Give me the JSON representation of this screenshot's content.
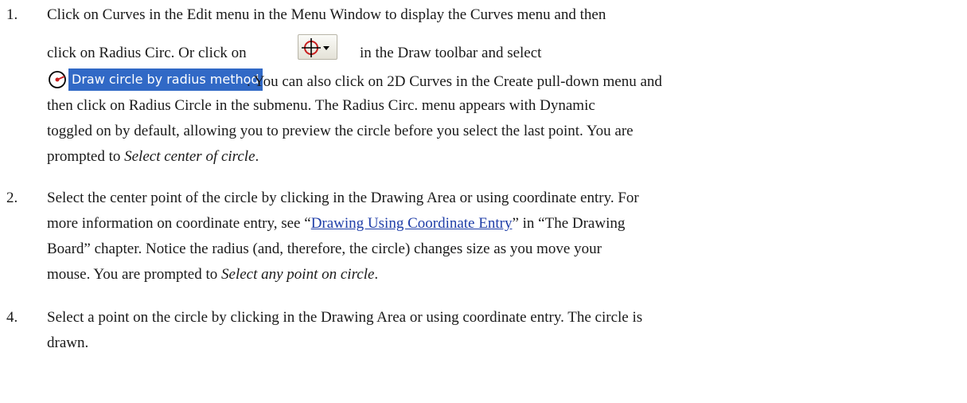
{
  "steps": [
    {
      "number": "1.",
      "line1": "Click on Curves in the Edit menu in the Menu Window to display the Curves menu and then",
      "line2_before": "click on Radius Circ. Or click on",
      "line2_after": "in the Draw toolbar and select",
      "menu_item_label": "Draw circle by radius method",
      "line3_after": ". You can also click on 2D Curves in the Create pull-down menu and",
      "line4": "then click on Radius Circle in the submenu. The Radius Circ. menu appears with Dynamic",
      "line5": "toggled on by default, allowing you to preview the circle before you select the last point. You are",
      "line6_before": "prompted to ",
      "line6_prompt": "Select center of circle",
      "line6_after": "."
    },
    {
      "number": "2.",
      "line1": "Select the center point of the circle by clicking in the Drawing Area or using coordinate entry. For",
      "line2_before": "more information on coordinate entry, see “",
      "link_text": "Drawing Using Coordinate Entry",
      "line2_after": "” in “The Drawing",
      "line3": "Board” chapter. Notice the radius (and, therefore, the circle) changes size as you move your",
      "line4_before": "mouse. You are prompted to ",
      "line4_prompt": "Select any point on circle",
      "line4_after": "."
    },
    {
      "number": "4.",
      "line1": "Select a point on the circle by clicking in the Drawing Area or using coordinate entry. The circle is",
      "line2": "drawn."
    }
  ],
  "icons": {
    "toolbar_button": "circle-crosshair-dropdown-icon",
    "menu_item": "circle-center-icon"
  },
  "colors": {
    "link": "#1f3ea8",
    "menu_highlight": "#3169c6",
    "icon_red": "#c81e1e"
  }
}
